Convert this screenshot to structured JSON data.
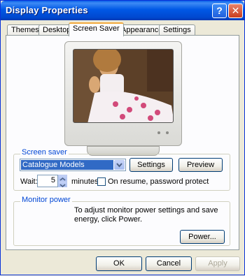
{
  "window": {
    "title": "Display Properties",
    "help_glyph": "?",
    "close_glyph": "✕"
  },
  "tabs": [
    {
      "label": "Themes"
    },
    {
      "label": "Desktop"
    },
    {
      "label": "Screen Saver",
      "active": true
    },
    {
      "label": "Appearance"
    },
    {
      "label": "Settings"
    }
  ],
  "screen_saver": {
    "group_label": "Screen saver",
    "selected": "Catalogue Models",
    "settings_label": "Settings",
    "preview_label": "Preview",
    "wait_label": "Wait:",
    "wait_value": "5",
    "minutes_label": "minutes",
    "resume_label": "On resume, password protect",
    "resume_checked": false
  },
  "monitor_power": {
    "group_label": "Monitor power",
    "description": "To adjust monitor power settings and save energy, click Power.",
    "power_label": "Power..."
  },
  "dialog_buttons": {
    "ok": "OK",
    "cancel": "Cancel",
    "apply": "Apply",
    "apply_enabled": false
  },
  "colors": {
    "titlebar": "#0058E6",
    "dialog_bg": "#ECE9D8",
    "selection": "#316AC5",
    "group_label": "#0046D5",
    "active_tab_accent": "#F2A93B"
  },
  "icons": {
    "help": "help-icon",
    "close": "close-icon",
    "dropdown": "chevron-down-icon",
    "spin_up": "spin-up-icon",
    "spin_down": "spin-down-icon"
  }
}
